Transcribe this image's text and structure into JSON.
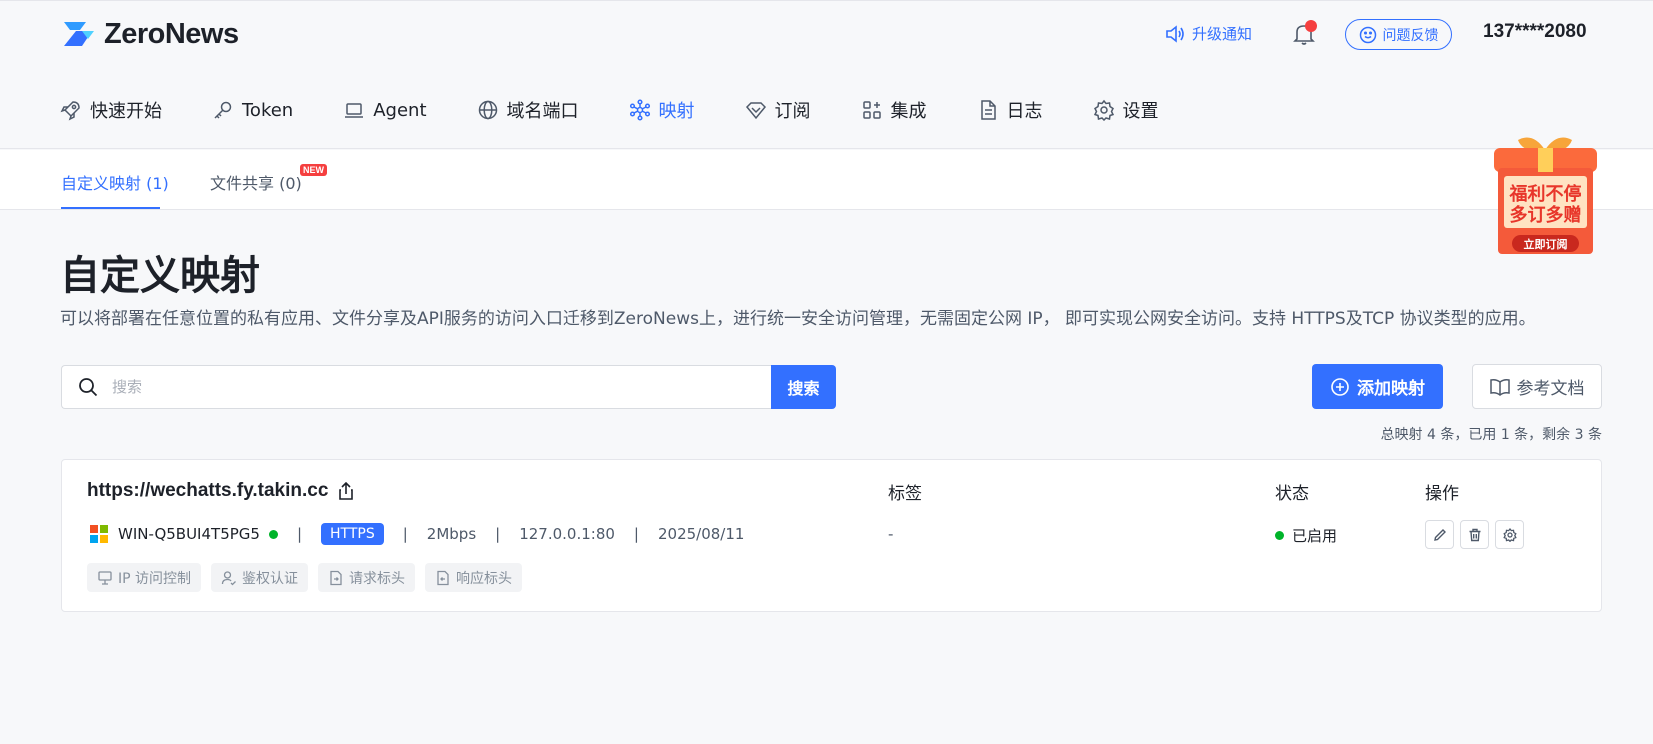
{
  "brand": {
    "name": "ZeroNews"
  },
  "header": {
    "upgrade_label": "升级通知",
    "feedback_label": "问题反馈",
    "user_phone": "137****2080"
  },
  "nav": {
    "items": [
      {
        "label": "快速开始",
        "icon": "rocket-icon"
      },
      {
        "label": "Token",
        "icon": "key-icon"
      },
      {
        "label": "Agent",
        "icon": "laptop-icon"
      },
      {
        "label": "域名端口",
        "icon": "globe-icon"
      },
      {
        "label": "映射",
        "icon": "network-icon",
        "active": true
      },
      {
        "label": "订阅",
        "icon": "diamond-icon"
      },
      {
        "label": "集成",
        "icon": "apps-icon"
      },
      {
        "label": "日志",
        "icon": "document-icon"
      },
      {
        "label": "设置",
        "icon": "gear-icon"
      }
    ]
  },
  "subtabs": {
    "custom": "自定义映射 (1)",
    "share": "文件共享 (0)",
    "new_badge": "NEW"
  },
  "promo": {
    "line1": "福利不停",
    "line2": "多订多赠",
    "cta": "立即订阅"
  },
  "page": {
    "title": "自定义映射",
    "description": "可以将部署在任意位置的私有应用、文件分享及API服务的访问入口迁移到ZeroNews上，进行统一安全访问管理，无需固定公网 IP， 即可实现公网安全访问。支持 HTTPS及TCP 协议类型的应用。"
  },
  "search": {
    "placeholder": "搜索",
    "button_label": "搜索"
  },
  "actions": {
    "add_label": "添加映射",
    "doc_label": "参考文档"
  },
  "summary": "总映射 4 条，已用 1 条，剩余 3 条",
  "mapping": {
    "url": "https://wechatts.fy.takin.cc",
    "columns": {
      "tags": "标签",
      "status": "状态",
      "ops": "操作"
    },
    "device": "WIN-Q5BUI4T5PG5",
    "protocol": "HTTPS",
    "bandwidth": "2Mbps",
    "target": "127.0.0.1:80",
    "date": "2025/08/11",
    "tags_value": "-",
    "status_label": "已启用",
    "features": [
      "IP 访问控制",
      "鉴权认证",
      "请求标头",
      "响应标头"
    ],
    "separator": "|"
  },
  "colors": {
    "primary": "#3370ff",
    "online": "#00b42a",
    "alert": "#f53f3f"
  }
}
